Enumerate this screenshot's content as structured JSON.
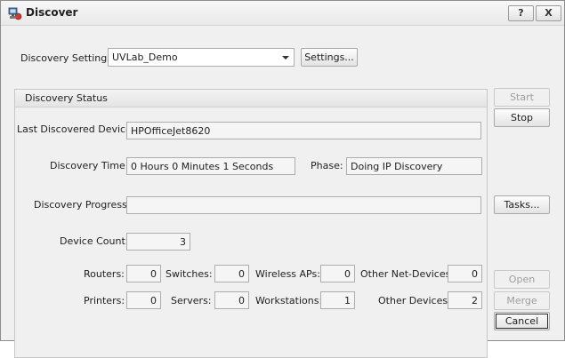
{
  "window": {
    "title": "Discover",
    "help_label": "?",
    "close_label": "X"
  },
  "settings": {
    "label": "Discovery Settings:",
    "value": "UVLab_Demo",
    "button_label": "Settings..."
  },
  "status": {
    "group_title": "Discovery Status",
    "last_device_label": "Last Discovered Device:",
    "last_device_value": "HPOfficeJet8620",
    "time_label": "Discovery Time:",
    "time_value": "0 Hours 0 Minutes 1 Seconds",
    "phase_label": "Phase:",
    "phase_value": "Doing IP Discovery",
    "progress_label": "Discovery Progress:",
    "progress_value": "",
    "device_count_label": "Device Count:",
    "device_count_value": "3"
  },
  "counts": {
    "routers": {
      "label": "Routers:",
      "value": "0"
    },
    "switches": {
      "label": "Switches:",
      "value": "0"
    },
    "wireless": {
      "label": "Wireless APs:",
      "value": "0"
    },
    "other_net": {
      "label": "Other Net-Devices:",
      "value": "0"
    },
    "printers": {
      "label": "Printers:",
      "value": "0"
    },
    "servers": {
      "label": "Servers:",
      "value": "0"
    },
    "workstations": {
      "label": "Workstations:",
      "value": "1"
    },
    "other_devices": {
      "label": "Other Devices:",
      "value": "2"
    }
  },
  "buttons": {
    "start": "Start",
    "stop": "Stop",
    "tasks": "Tasks...",
    "open": "Open",
    "merge": "Merge",
    "cancel": "Cancel"
  }
}
